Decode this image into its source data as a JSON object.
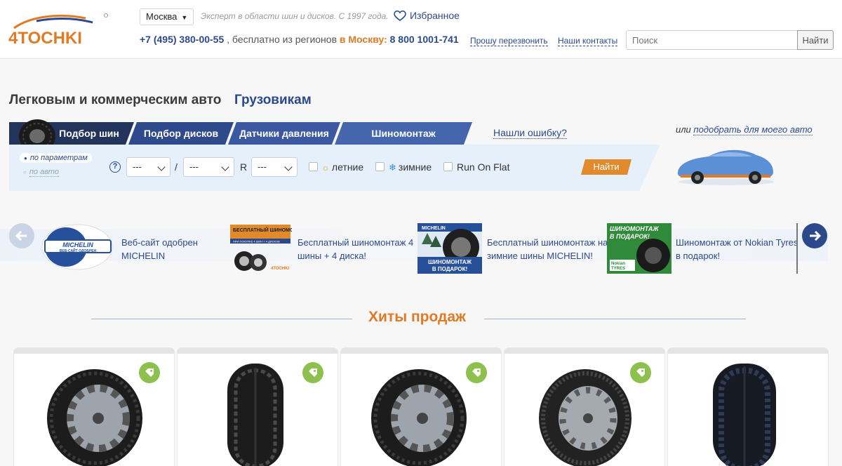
{
  "header": {
    "logo_text": "4TOCHKI",
    "city": "Москва",
    "tagline": "Эксперт в области шин и дисков. С 1997 года.",
    "favorites": "Избранное",
    "phone_main": "+7 (495) 380-00-55",
    "phone_note": ", бесплатно из регионов",
    "to_moscow": "в Москву:",
    "phone_free": "8 800 1001-741",
    "callback": "Прошу перезвонить",
    "contacts": "Наши контакты",
    "search_placeholder": "Поиск",
    "search_button": "Найти"
  },
  "categories": {
    "main": "Легковым и коммерческим авто",
    "trucks": "Грузовикам"
  },
  "tabs": [
    "Подбор шин",
    "Подбор дисков",
    "Датчики давления",
    "Шиномонтаж"
  ],
  "error_link": "Нашли ошибку?",
  "filter": {
    "mode_params": "по параметрам",
    "mode_auto": "по авто",
    "help": "?",
    "width": "---",
    "slash": "/",
    "profile": "---",
    "r": "R",
    "diameter": "---",
    "summer": "летние",
    "winter": "зимние",
    "runflat": "Run On Flat",
    "find": "Найти"
  },
  "car_pick": {
    "or": "или",
    "link": "подобрать для моего авто"
  },
  "promos": [
    {
      "text1": "Веб-сайт одобрен",
      "text2": "MICHELIN"
    },
    {
      "text1": "Бесплатный шиномонтаж 4",
      "text2": "шины + 4 диска!"
    },
    {
      "text1": "Бесплатный шиномонтаж на",
      "text2": "зимние шины MICHELIN!"
    },
    {
      "text1": "Шиномонтаж от Nokian Tyres",
      "text2": "в подарок!"
    }
  ],
  "promo_images": {
    "michelin_line1": "MICHELIN",
    "michelin_line2": "ВЕБ-САЙТ ОДОБРЕН",
    "free_fit": "БЕСПЛАТНЫЙ ШИНОМОНТАЖ",
    "free_fit_sub": "ПРИ ПОКУПКЕ 4 ШИН + 4 ДИСКОВ",
    "free_fit_brand": "4TOCHKI",
    "winter_brand": "MICHELIN",
    "winter_line1": "ШИНОМОНТАЖ",
    "winter_line2": "В ПОДАРОК!",
    "nokian_line1": "ШИНОМОНТАЖ",
    "nokian_line2": "В ПОДАРОК!",
    "nokian_brand1": "Nokian",
    "nokian_brand2": "TYRES"
  },
  "hits_title": "Хиты продаж",
  "colors": {
    "brand_blue": "#2c4a8b",
    "brand_orange": "#e07b24",
    "badge_green": "#8dc04c"
  }
}
